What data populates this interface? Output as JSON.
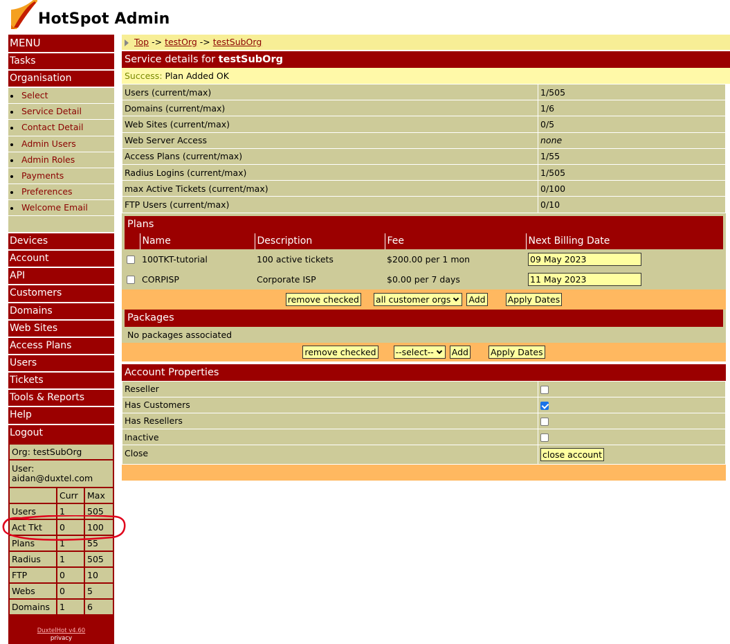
{
  "app": {
    "title": "HotSpot Admin"
  },
  "sidebar": {
    "menu_title": "MENU",
    "items_top": [
      {
        "label": "Tasks"
      },
      {
        "label": "Organisation"
      }
    ],
    "org_subitems": [
      {
        "label": "Select"
      },
      {
        "label": "Service Detail"
      },
      {
        "label": "Contact Detail"
      },
      {
        "label": "Admin Users"
      },
      {
        "label": "Admin Roles"
      },
      {
        "label": "Payments"
      },
      {
        "label": "Preferences"
      },
      {
        "label": "Welcome Email"
      }
    ],
    "items_bottom": [
      {
        "label": "Devices"
      },
      {
        "label": "Account"
      },
      {
        "label": "API"
      },
      {
        "label": "Customers"
      },
      {
        "label": "Domains"
      },
      {
        "label": "Web Sites"
      },
      {
        "label": "Access Plans"
      },
      {
        "label": "Users"
      },
      {
        "label": "Tickets"
      },
      {
        "label": "Tools & Reports"
      },
      {
        "label": "Help"
      },
      {
        "label": "Logout"
      }
    ],
    "org_line": "Org: testSubOrg",
    "user_line": "User: aidan@duxtel.com",
    "stats_header": {
      "curr": "Curr",
      "max": "Max"
    },
    "stats": [
      {
        "name": "Users",
        "curr": "1",
        "max": "505"
      },
      {
        "name": "Act Tkt",
        "curr": "0",
        "max": "100"
      },
      {
        "name": "Plans",
        "curr": "1",
        "max": "55"
      },
      {
        "name": "Radius",
        "curr": "1",
        "max": "505"
      },
      {
        "name": "FTP",
        "curr": "0",
        "max": "10"
      },
      {
        "name": "Webs",
        "curr": "0",
        "max": "5"
      },
      {
        "name": "Domains",
        "curr": "1",
        "max": "6"
      }
    ],
    "footer_version": "DuxtelHot v4.60",
    "footer_privacy": "privacy"
  },
  "breadcrumb": {
    "items": [
      "Top",
      "testOrg",
      "testSubOrg"
    ],
    "separator": "->"
  },
  "service": {
    "title_prefix": "Service details for ",
    "title_org": "testSubOrg",
    "success_label": "Success:",
    "success_message": "Plan Added OK",
    "rows": [
      {
        "label": "Users (current/max)",
        "value": "1/505"
      },
      {
        "label": "Domains (current/max)",
        "value": "1/6"
      },
      {
        "label": "Web Sites (current/max)",
        "value": "0/5"
      },
      {
        "label": "Web Server Access",
        "value": "none"
      },
      {
        "label": "Access Plans (current/max)",
        "value": "1/55"
      },
      {
        "label": "Radius Logins (current/max)",
        "value": "1/505"
      },
      {
        "label": "max Active Tickets (current/max)",
        "value": "0/100"
      },
      {
        "label": "FTP Users (current/max)",
        "value": "0/10"
      }
    ]
  },
  "plans": {
    "title": "Plans",
    "columns": {
      "name": "Name",
      "description": "Description",
      "fee": "Fee",
      "next_billing": "Next Billing Date"
    },
    "rows": [
      {
        "name": "100TKT-tutorial",
        "description": "100 active tickets",
        "fee": "$200.00 per 1 mon",
        "next_billing": "09 May 2023"
      },
      {
        "name": "CORPISP",
        "description": "Corporate ISP",
        "fee": "$0.00 per 7 days",
        "next_billing": "11 May 2023"
      }
    ],
    "remove_label": "remove checked",
    "scope_selected": "all customer orgs",
    "add_label": "Add",
    "apply_dates_label": "Apply Dates"
  },
  "packages": {
    "title": "Packages",
    "empty_text": "No packages associated",
    "remove_label": "remove checked",
    "select_selected": "--select--",
    "add_label": "Add",
    "apply_dates_label": "Apply Dates"
  },
  "account_properties": {
    "title": "Account Properties",
    "reseller_label": "Reseller",
    "has_customers_label": "Has Customers",
    "has_customers_checked": true,
    "has_resellers_label": "Has Resellers",
    "inactive_label": "Inactive",
    "close_label": "Close",
    "close_button": "close account"
  },
  "colors": {
    "brand_red": "#9b0000",
    "panel_khaki": "#cdcb99",
    "bar_orange": "#ffb860",
    "highlight_yellow": "#f7ee96",
    "annotation_red": "#e0001b"
  }
}
